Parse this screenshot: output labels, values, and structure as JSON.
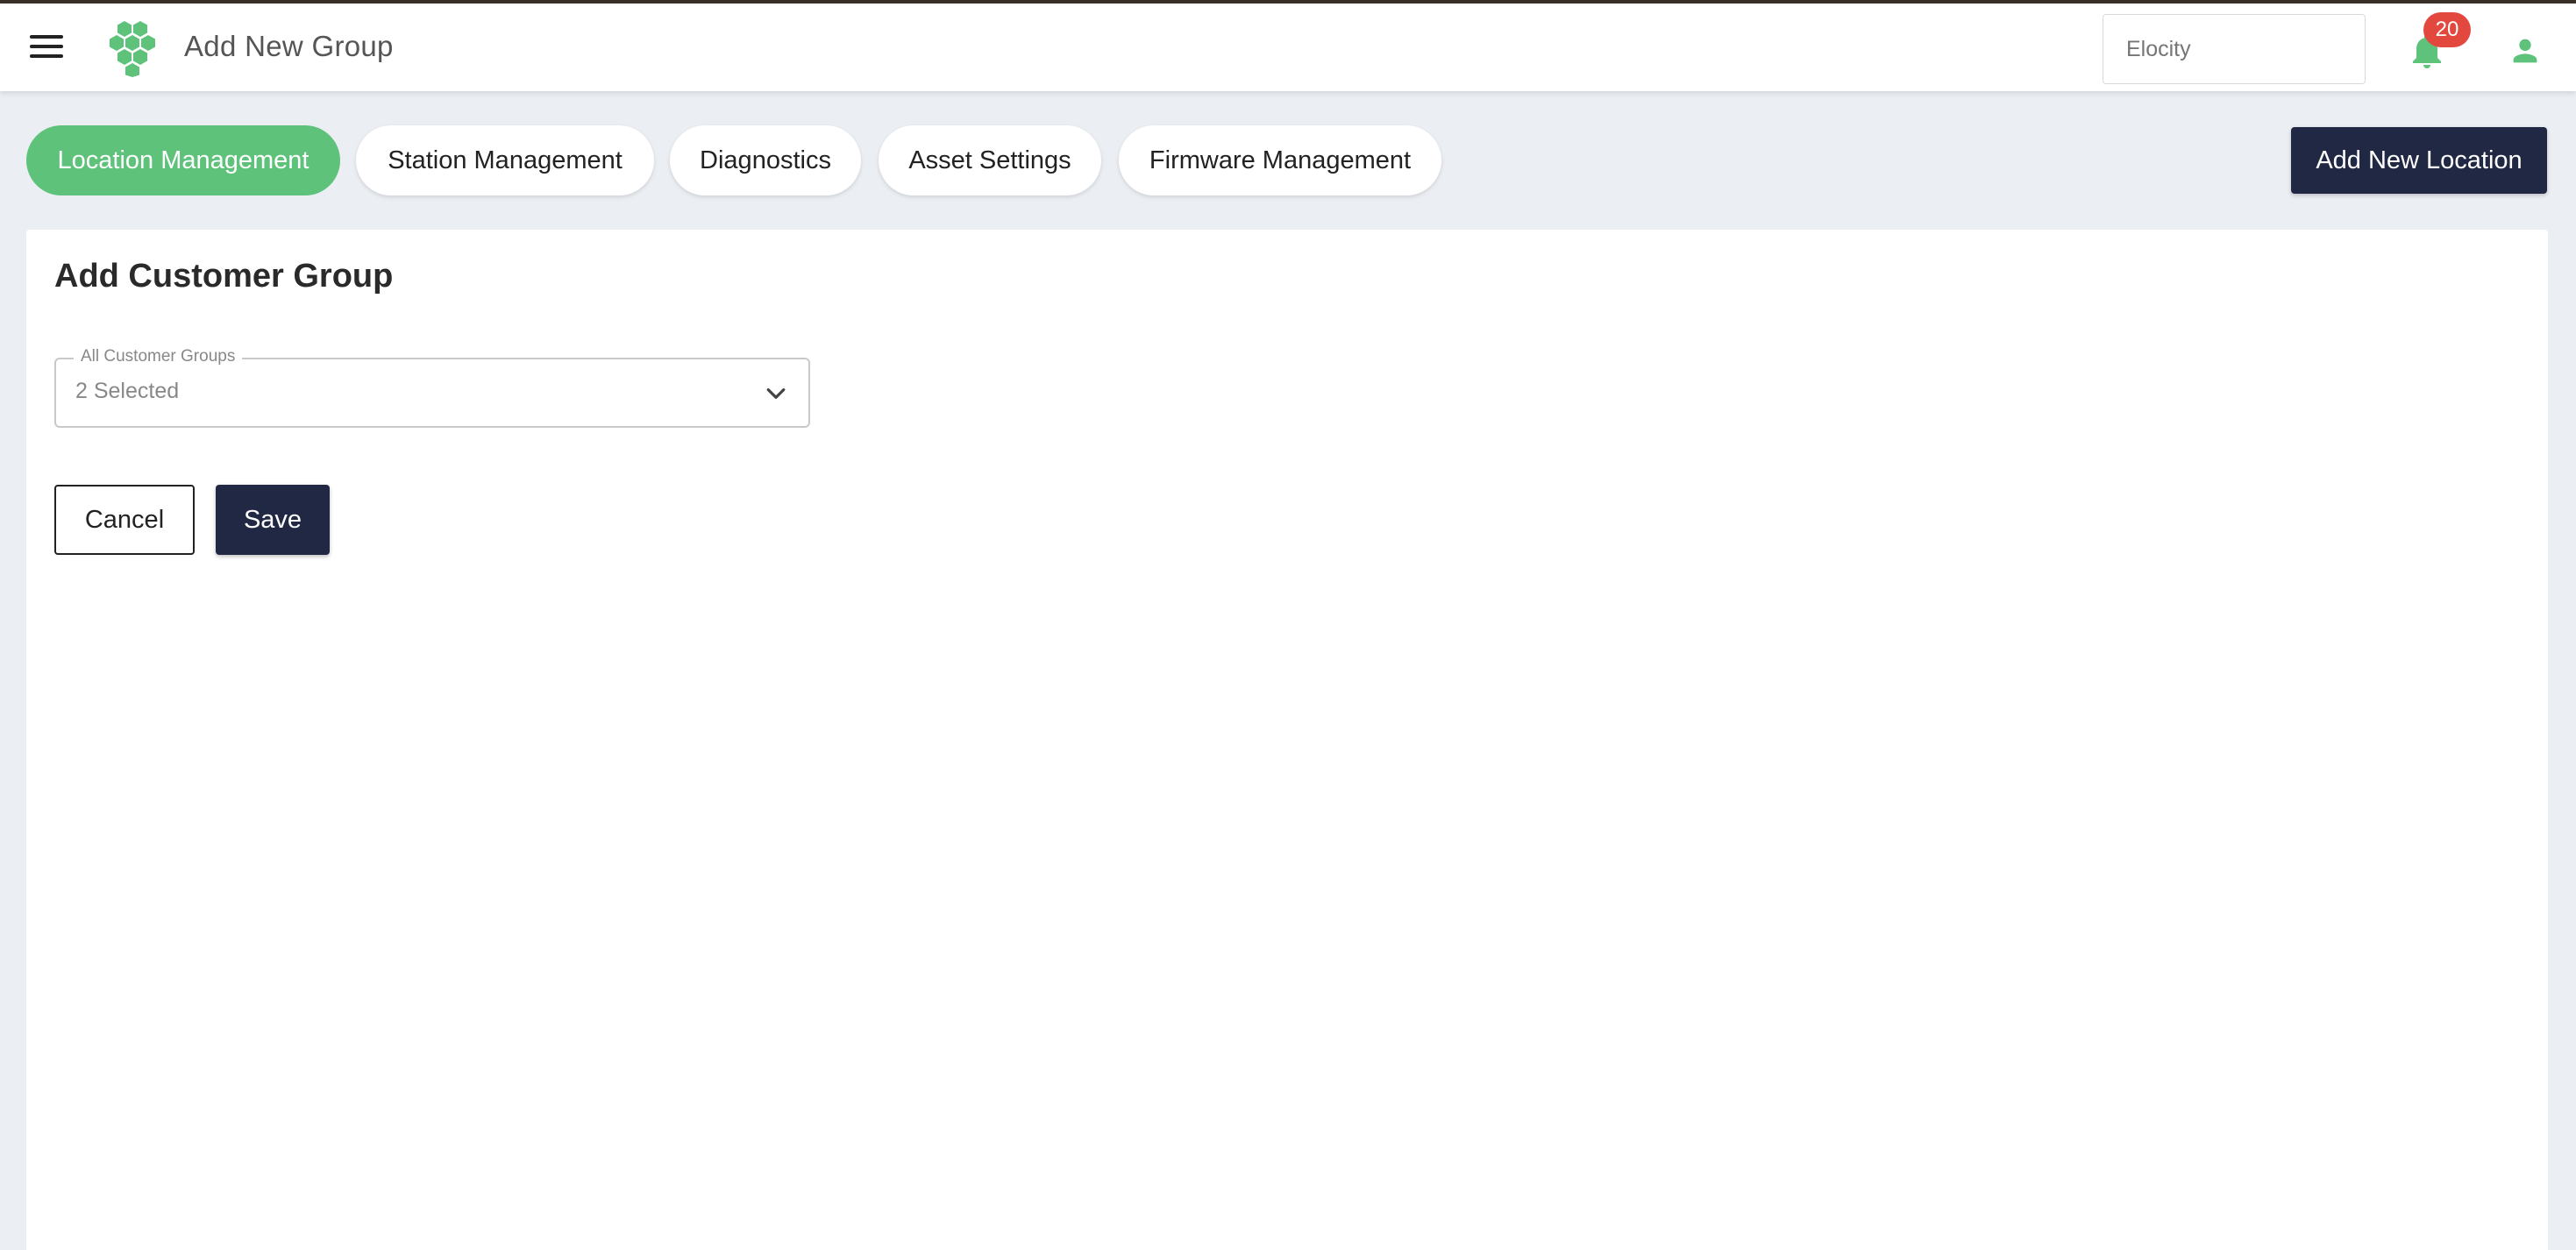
{
  "header": {
    "title": "Add New Group",
    "org_placeholder": "Elocity",
    "notification_count": "20",
    "accent_color": "#5ec27a"
  },
  "tabs": [
    {
      "label": "Location Management",
      "active": true
    },
    {
      "label": "Station Management",
      "active": false
    },
    {
      "label": "Diagnostics",
      "active": false
    },
    {
      "label": "Asset Settings",
      "active": false
    },
    {
      "label": "Firmware Management",
      "active": false
    }
  ],
  "actions": {
    "add_location_label": "Add New Location"
  },
  "form": {
    "title": "Add Customer Group",
    "groups_field": {
      "label": "All Customer Groups",
      "value": "2 Selected"
    },
    "cancel_label": "Cancel",
    "save_label": "Save"
  },
  "icons": {
    "menu": "hamburger-menu-icon",
    "logo": "hexagon-cluster-logo",
    "bell": "bell-icon",
    "user": "user-icon",
    "chevron": "chevron-down-icon"
  }
}
